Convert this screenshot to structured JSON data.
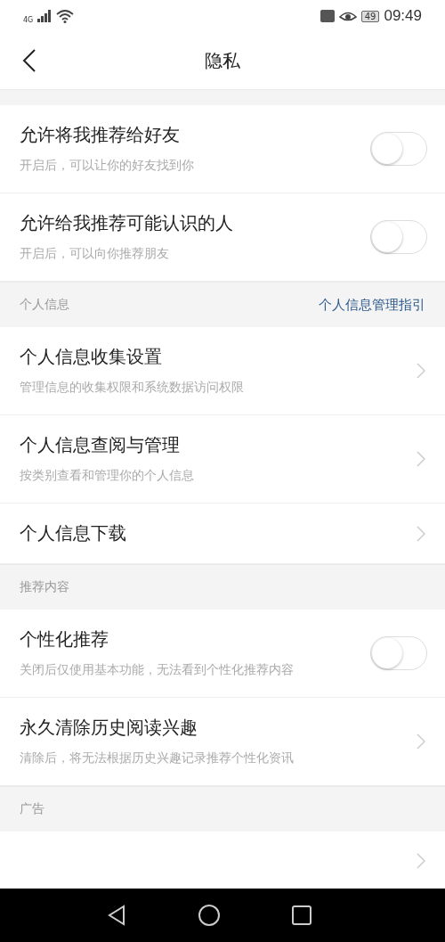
{
  "status_bar": {
    "network": "4G",
    "time": "09:49",
    "battery": "49"
  },
  "header": {
    "title": "隐私"
  },
  "sections": [
    {
      "items": [
        {
          "kind": "toggle",
          "title": "允许将我推荐给好友",
          "subtitle": "开启后，可以让你的好友找到你",
          "on": false
        },
        {
          "kind": "toggle",
          "title": "允许给我推荐可能认识的人",
          "subtitle": "开启后，可以向你推荐朋友",
          "on": false
        }
      ]
    },
    {
      "title": "个人信息",
      "link": "个人信息管理指引",
      "items": [
        {
          "kind": "link",
          "title": "个人信息收集设置",
          "subtitle": "管理信息的收集权限和系统数据访问权限"
        },
        {
          "kind": "link",
          "title": "个人信息查阅与管理",
          "subtitle": "按类别查看和管理你的个人信息"
        },
        {
          "kind": "link",
          "title": "个人信息下载"
        }
      ]
    },
    {
      "title": "推荐内容",
      "items": [
        {
          "kind": "toggle",
          "title": "个性化推荐",
          "subtitle": "关闭后仅使用基本功能，无法看到个性化推荐内容",
          "on": false
        },
        {
          "kind": "link",
          "title": "永久清除历史阅读兴趣",
          "subtitle": "清除后，将无法根据历史兴趣记录推荐个性化资讯"
        }
      ]
    },
    {
      "title": "广告",
      "items": [
        {
          "kind": "link"
        }
      ]
    }
  ]
}
